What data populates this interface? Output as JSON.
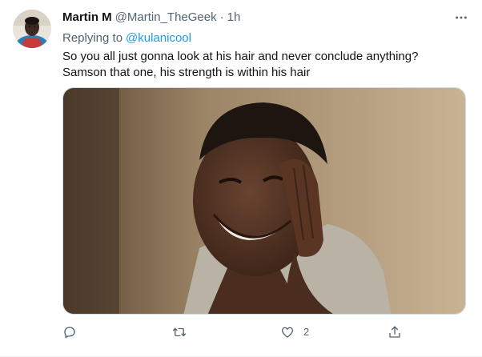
{
  "tweet": {
    "author": {
      "display_name": "Martin M",
      "handle": "@Martin_TheGeek",
      "separator": "·",
      "time": "1h"
    },
    "reply_to": {
      "prefix": "Replying to",
      "handle": "@kulanicool"
    },
    "text": "So you all just gonna look at his hair and never conclude anything? Samson that one, his strength is within his hair",
    "media": {
      "type": "photo"
    },
    "actions": {
      "reply": {
        "icon": "reply-icon",
        "count": ""
      },
      "retweet": {
        "icon": "retweet-icon",
        "count": ""
      },
      "like": {
        "icon": "heart-icon",
        "count": "2"
      },
      "share": {
        "icon": "share-icon",
        "count": ""
      }
    }
  },
  "colors": {
    "accent": "#1d9bf0",
    "secondary_text": "#536471",
    "primary_text": "#0f1419",
    "border": "#cfd9de"
  }
}
